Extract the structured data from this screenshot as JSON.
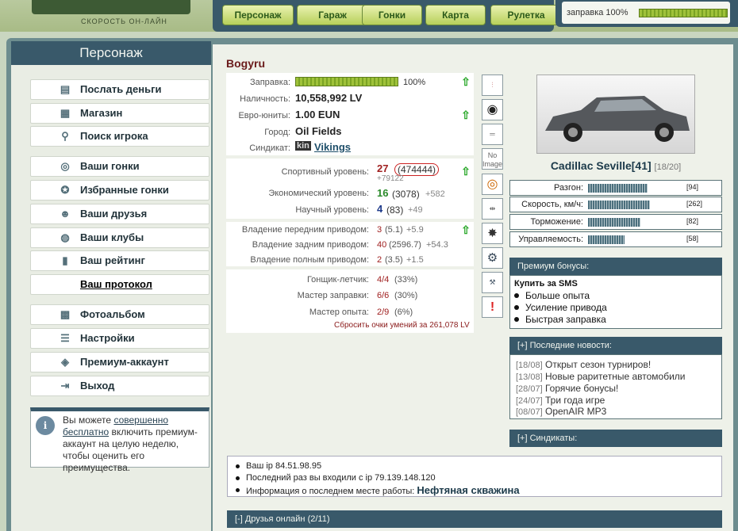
{
  "header": {
    "logo_subtitle": "СКОРОСТЬ ОН-ЛАЙН",
    "nav": [
      "Персонаж",
      "Гараж",
      "Гонки",
      "Карта",
      "Рулетка"
    ],
    "fuel_label": "заправка 100%",
    "fuel_level": 1.0
  },
  "sidebar": {
    "title": "Персонаж",
    "items": [
      {
        "label": "Послать деньги",
        "icon": "money-icon"
      },
      {
        "label": "Магазин",
        "icon": "shop-icon"
      },
      {
        "label": "Поиск игрока",
        "icon": "search-icon"
      },
      {
        "label": "Ваши гонки",
        "icon": "steering-wheel-icon"
      },
      {
        "label": "Избранные гонки",
        "icon": "star-wheel-icon"
      },
      {
        "label": "Ваши друзья",
        "icon": "friends-icon"
      },
      {
        "label": "Ваши клубы",
        "icon": "globe-icon"
      },
      {
        "label": "Ваш рейтинг",
        "icon": "rating-icon"
      },
      {
        "label": "Ваш протокол",
        "icon": ""
      },
      {
        "label": "Фотоальбом",
        "icon": "photo-icon"
      },
      {
        "label": "Настройки",
        "icon": "settings-icon"
      },
      {
        "label": "Премиум-аккаунт",
        "icon": "premium-icon"
      },
      {
        "label": "Выход",
        "icon": "exit-icon"
      }
    ],
    "info": {
      "p1": "Вы можете ",
      "link": "совершенно бесплатно",
      "p2": " включить премиум-аккаунт на целую неделю, чтобы оценить его преимущества."
    }
  },
  "player": {
    "name": "Bogyru",
    "fuel_label": "Заправка:",
    "fuel_value": "100%",
    "cash_label": "Наличность:",
    "cash_value": "10,558,992 LV",
    "euro_label": "Евро-юниты:",
    "euro_value": "1.00 EUN",
    "city_label": "Город:",
    "city_value": "Oil Fields",
    "syndicate_label": "Синдикат:",
    "syndicate_tag": "kin",
    "syndicate_value": "Vikings",
    "sport_label": "Спортивный уровень:",
    "sport_level": "27",
    "sport_points": "(474444)",
    "sport_delta": "+79122",
    "econ_label": "Экономический уровень:",
    "econ_level": "16",
    "econ_points": "(3078)",
    "econ_delta": "+582",
    "sci_label": "Научный уровень:",
    "sci_level": "4",
    "sci_points": "(83)",
    "sci_delta": "+49",
    "fwd_label": "Владение передним приводом:",
    "fwd_value": "3",
    "fwd_points": "(5.1)",
    "fwd_delta": "+5.9",
    "rwd_label": "Владение задним приводом:",
    "rwd_value": "40",
    "rwd_points": "(2596.7)",
    "rwd_delta": "+54.3",
    "awd_label": "Владение полным приводом:",
    "awd_value": "2",
    "awd_points": "(3.5)",
    "awd_delta": "+1.5",
    "pilot_label": "Гонщик-летчик:",
    "pilot_value": "4/4",
    "pilot_pct": "(33%)",
    "refuel_label": "Мастер заправки:",
    "refuel_value": "6/6",
    "refuel_pct": "(30%)",
    "exp_label": "Мастер опыта:",
    "exp_value": "2/9",
    "exp_pct": "(6%)",
    "reset": "Сбросить очки умений за 261,078 LV"
  },
  "car": {
    "name": "Cadillac Seville[41]",
    "slots": "[18/20]",
    "no_image": "No Image",
    "stats": [
      {
        "label": "Разгон:",
        "value": "[94]",
        "level": 0.94
      },
      {
        "label": "Скорость, км/ч:",
        "value": "[262]",
        "level": 0.98
      },
      {
        "label": "Торможение:",
        "value": "[82]",
        "level": 0.82
      },
      {
        "label": "Управляемость:",
        "value": "[58]",
        "level": 0.58
      }
    ]
  },
  "premium": {
    "title": "Премиум бонусы:",
    "buy": "Купить за SMS",
    "items": [
      "Больше опыта",
      "Усиление привода",
      "Быстрая заправка"
    ]
  },
  "news": {
    "title": "[+]   Последние новости:",
    "items": [
      {
        "date": "[18/08]",
        "text": "Открыт сезон турниров!"
      },
      {
        "date": "[13/08]",
        "text": "Новые раритетные автомобили"
      },
      {
        "date": "[28/07]",
        "text": "Горячие бонусы!"
      },
      {
        "date": "[24/07]",
        "text": "Три года игре"
      },
      {
        "date": "[08/07]",
        "text": "OpenAIR MP3"
      }
    ]
  },
  "syndicates": {
    "title": "[+]   Синдикаты:"
  },
  "ip": {
    "l1": "Ваш ip 84.51.98.95",
    "l2": "Последний раз вы входили с ip 79.139.148.120",
    "l3": "Информация о последнем месте работы: ",
    "l3b": "Нефтяная скважина"
  },
  "friends": {
    "title": "[-]   Друзья онлайн (2/11)"
  }
}
